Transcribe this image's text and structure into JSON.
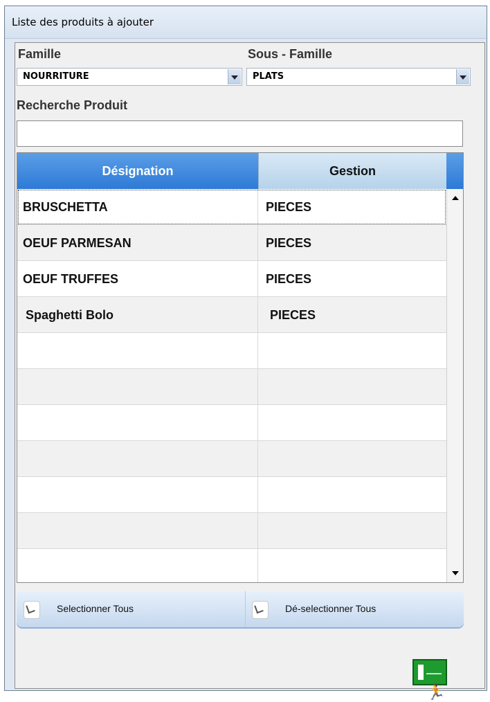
{
  "window": {
    "title": "Liste des produits à ajouter"
  },
  "filters": {
    "famille_label": "Famille",
    "famille_value": "NOURRITURE",
    "sous_famille_label": "Sous - Famille",
    "sous_famille_value": "PLATS",
    "recherche_label": "Recherche Produit",
    "recherche_value": ""
  },
  "table": {
    "columns": [
      "Désignation",
      "Gestion"
    ],
    "rows": [
      {
        "designation": "BRUSCHETTA",
        "gestion": "PIECES"
      },
      {
        "designation": "OEUF PARMESAN",
        "gestion": "PIECES"
      },
      {
        "designation": "OEUF TRUFFES",
        "gestion": "PIECES"
      },
      {
        "designation": "Spaghetti Bolo",
        "gestion": "PIECES"
      },
      {
        "designation": "",
        "gestion": ""
      },
      {
        "designation": "",
        "gestion": ""
      },
      {
        "designation": "",
        "gestion": ""
      },
      {
        "designation": "",
        "gestion": ""
      },
      {
        "designation": "",
        "gestion": ""
      },
      {
        "designation": "",
        "gestion": ""
      },
      {
        "designation": "",
        "gestion": ""
      }
    ]
  },
  "actions": {
    "select_all_label": "Selectionner Tous",
    "deselect_all_label": "Dé-selectionner Tous",
    "exit_icon": "exit-door-icon"
  },
  "colors": {
    "header_active": "#2d7ad6",
    "header_inactive": "#b6d2ea",
    "exit_green": "#1e9b2f"
  }
}
